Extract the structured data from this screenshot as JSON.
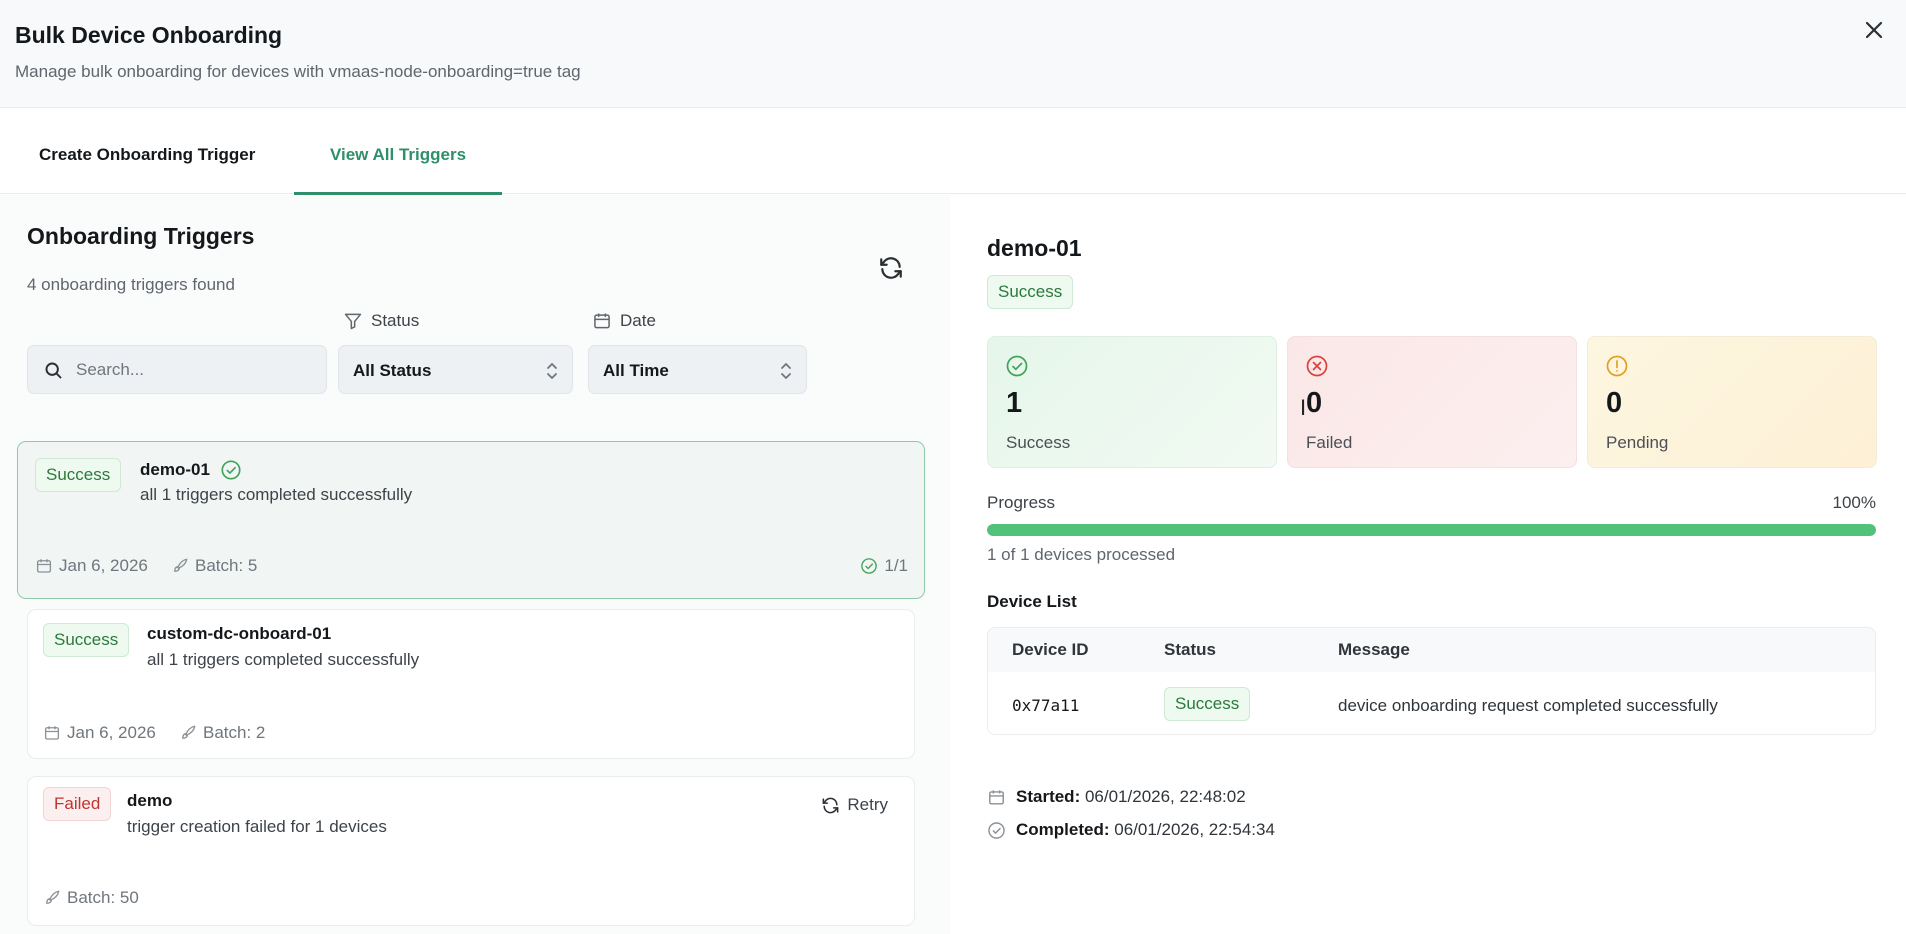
{
  "header": {
    "title": "Bulk Device Onboarding",
    "subtitle": "Manage bulk onboarding for devices with vmaas-node-onboarding=true tag"
  },
  "tabs": [
    {
      "label": "Create Onboarding Trigger",
      "active": false
    },
    {
      "label": "View All Triggers",
      "active": true
    }
  ],
  "left": {
    "title": "Onboarding Triggers",
    "count_text": "4 onboarding triggers found",
    "filters": {
      "search_placeholder": "Search...",
      "status_label": "Status",
      "status_value": "All Status",
      "date_label": "Date",
      "date_value": "All Time"
    },
    "triggers": [
      {
        "badge": "Success",
        "name": "demo-01",
        "message": "all 1 triggers completed successfully",
        "date": "Jan 6, 2026",
        "batch": "Batch: 5",
        "ratio": "1/1",
        "selected": true
      },
      {
        "badge": "Success",
        "name": "custom-dc-onboard-01",
        "message": "all 1 triggers completed successfully",
        "date": "Jan 6, 2026",
        "batch": "Batch: 2"
      },
      {
        "badge": "Failed",
        "name": "demo",
        "message": "trigger creation failed for 1 devices",
        "batch": "Batch: 50",
        "retry_label": "Retry"
      }
    ]
  },
  "detail": {
    "title": "demo-01",
    "badge": "Success",
    "stats": [
      {
        "value": "1",
        "label": "Success",
        "icon": "check-circle-icon",
        "color": "#3fa35a"
      },
      {
        "value": "0",
        "label": "Failed",
        "icon": "x-circle-icon",
        "color": "#d9423a"
      },
      {
        "value": "0",
        "label": "Pending",
        "icon": "alert-circle-icon",
        "color": "#e0a020"
      }
    ],
    "progress": {
      "label": "Progress",
      "percent_text": "100%",
      "value": 1.0,
      "note": "1 of 1 devices processed"
    },
    "device_list": {
      "title": "Device List",
      "columns": [
        "Device ID",
        "Status",
        "Message"
      ],
      "rows": [
        {
          "device_id": "0x77a11",
          "status": "Success",
          "message": "device onboarding request completed successfully"
        }
      ]
    },
    "started_label": "Started:",
    "started_value": "06/01/2026, 22:48:02",
    "completed_label": "Completed:",
    "completed_value": "06/01/2026, 22:54:34"
  },
  "colors": {
    "accent": "#2f8f6b",
    "success": "#2b7a3b",
    "failed": "#c0352f",
    "progress_fill": "#52c179"
  }
}
